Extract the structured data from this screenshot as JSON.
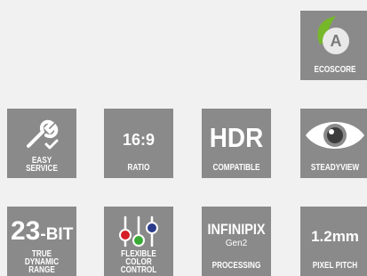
{
  "colors": {
    "page_bg": "#f1f1f1",
    "tile_bg": "#8a8a8a",
    "text": "#ffffff",
    "eco_leaf": "#76b82a",
    "eco_letter_bg": "#e9e9e9",
    "knob_red": "#d41f26",
    "knob_green": "#3aaa35",
    "knob_blue": "#2a3a8c"
  },
  "tiles": {
    "ecoscore": {
      "letter": "A",
      "caption": "ECOSCORE",
      "icon": "leaf-icon"
    },
    "easy_service": {
      "caption_line1": "EASY",
      "caption_line2": "SERVICE",
      "icon": "wrench-check-icon"
    },
    "ratio": {
      "value": "16:9",
      "caption": "RATIO"
    },
    "hdr": {
      "value": "HDR",
      "caption": "COMPATIBLE"
    },
    "steadyview": {
      "caption": "STEADYVIEW",
      "icon": "eye-icon"
    },
    "bit_depth": {
      "number": "23",
      "unit": "-BIT",
      "caption_line1": "TRUE",
      "caption_line2": "DYNAMIC RANGE"
    },
    "color_control": {
      "caption_line1": "FLEXIBLE",
      "caption_line2": "COLOR CONTROL",
      "icon": "color-sliders-icon"
    },
    "infinipix": {
      "brand": "INFINIPIX",
      "generation": "Gen2",
      "caption": "PROCESSING"
    },
    "pixel_pitch": {
      "value": "1.2mm",
      "caption": "PIXEL PITCH"
    }
  }
}
